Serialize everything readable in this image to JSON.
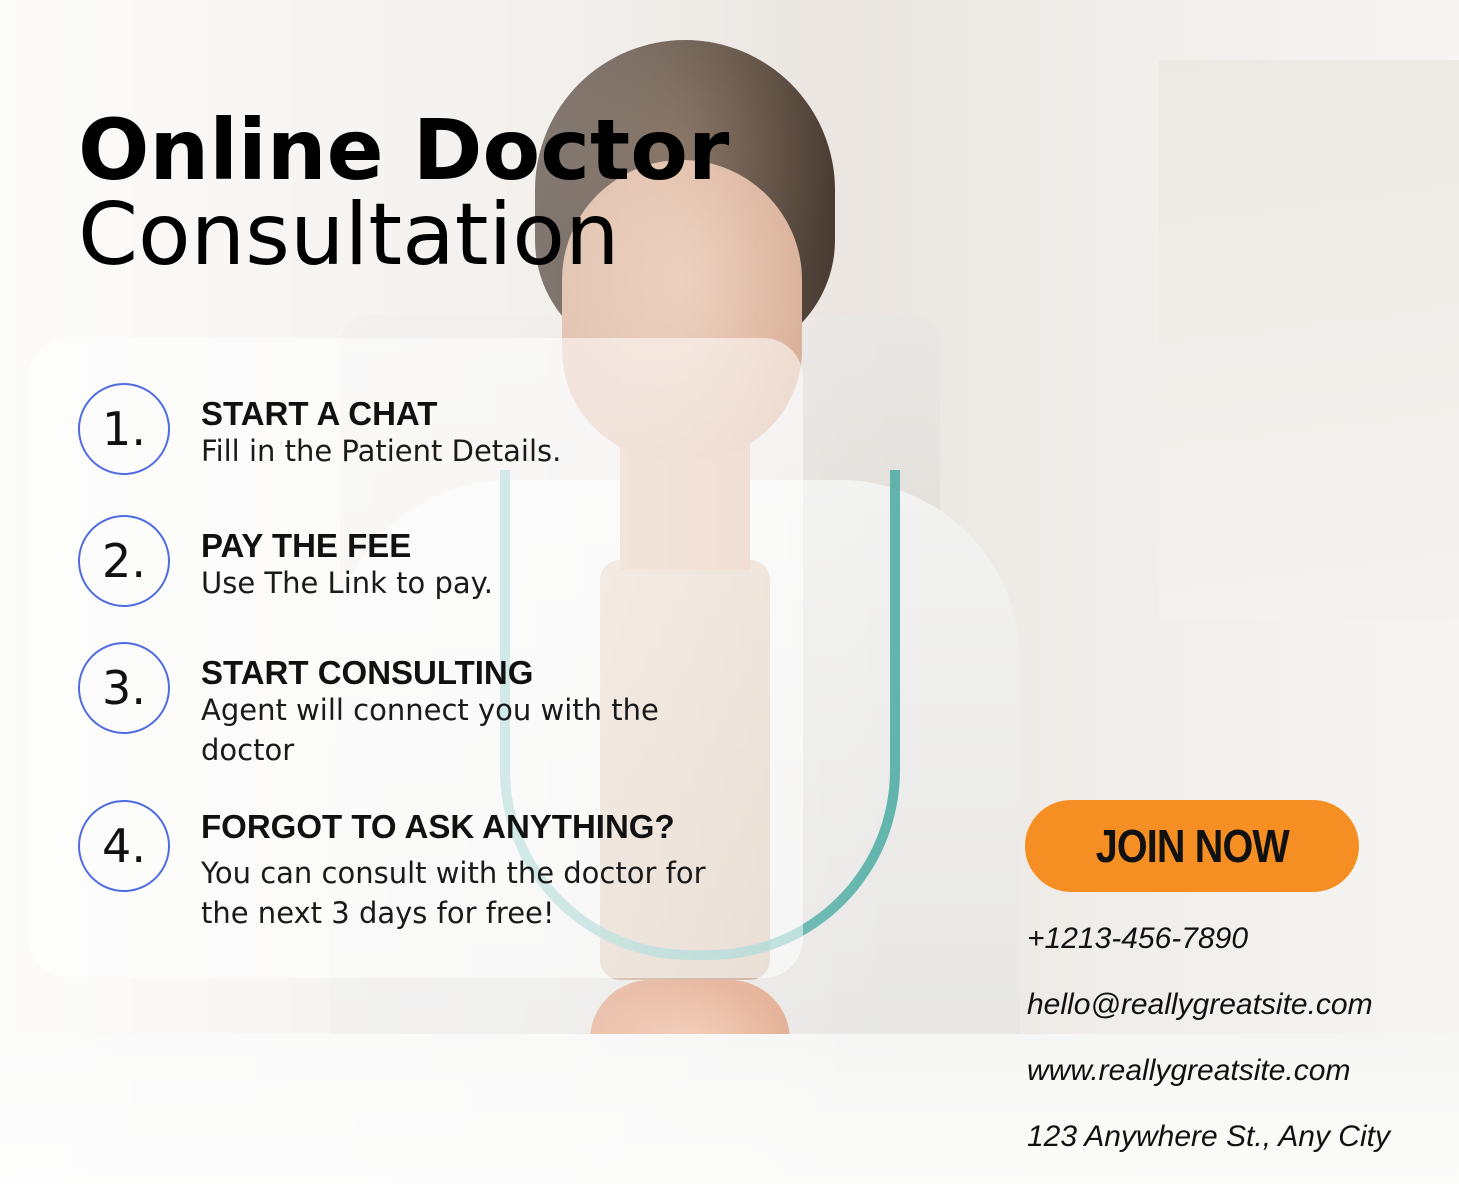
{
  "title": {
    "line1": "Online Doctor",
    "line2": "Consultation"
  },
  "steps": [
    {
      "number": "1.",
      "heading": "START A CHAT",
      "description": "Fill in the Patient Details."
    },
    {
      "number": "2.",
      "heading": "PAY THE FEE",
      "description": "Use The Link to pay."
    },
    {
      "number": "3.",
      "heading": "START CONSULTING",
      "description": "Agent will connect you with the doctor"
    },
    {
      "number": "4.",
      "heading": "FORGOT TO ASK ANYTHING?",
      "description": "You can consult with the doctor for the next 3 days for free!"
    }
  ],
  "cta": {
    "label": "JOIN NOW",
    "color": "#f58f23"
  },
  "contact": {
    "phone": "+1213-456-7890",
    "email": "hello@reallygreatsite.com",
    "website": "www.reallygreatsite.com",
    "address": "123 Anywhere St., Any City"
  },
  "colors": {
    "circle_border": "#4e6be0",
    "text": "#111111"
  }
}
